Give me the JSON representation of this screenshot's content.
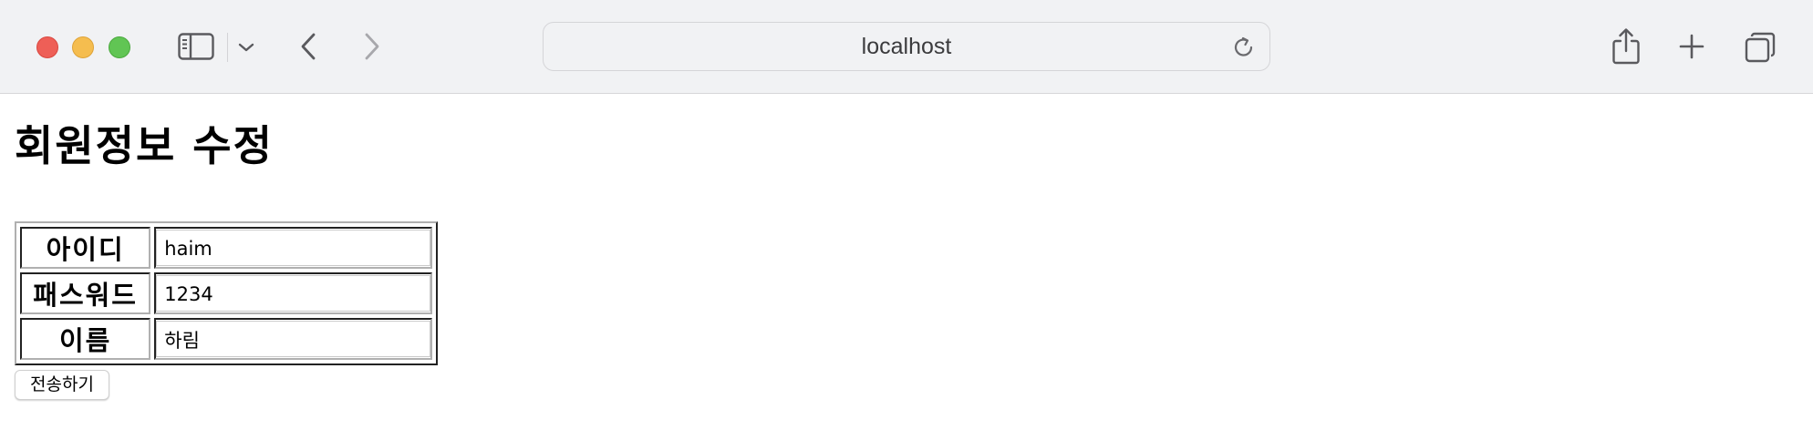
{
  "browser": {
    "url": "localhost",
    "icons": {
      "sidebar": "sidebar-icon",
      "chevron": "chevron-down-icon",
      "back": "back-arrow-icon",
      "forward": "forward-arrow-icon",
      "reload": "reload-icon",
      "share": "share-icon",
      "new_tab": "plus-icon",
      "tabs": "tab-overview-icon"
    }
  },
  "page": {
    "title": "회원정보 수정",
    "fields": [
      {
        "label": "아이디",
        "value": "haim"
      },
      {
        "label": "패스워드",
        "value": "1234"
      },
      {
        "label": "이름",
        "value": "하림"
      }
    ],
    "submit_label": "전송하기"
  },
  "colors": {
    "toolbar_bg": "#f1f2f4",
    "close": "#ee5f57",
    "minimize": "#f5bd4f",
    "zoom": "#61c554"
  }
}
